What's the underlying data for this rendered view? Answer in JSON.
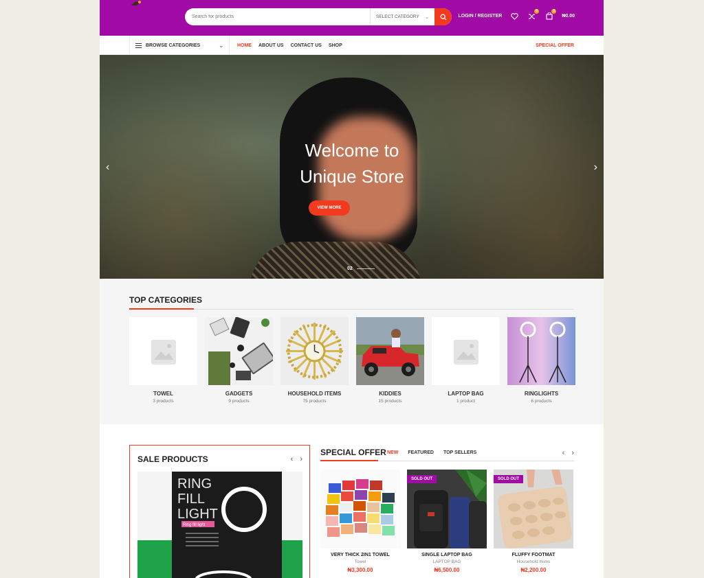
{
  "header": {
    "search_placeholder": "Search for products",
    "select_category": "SELECT CATEGORY",
    "login": "LOGIN / REGISTER",
    "compare_count": "0",
    "cart_count": "0",
    "cart_total": "₦0.00"
  },
  "nav": {
    "browse": "BROWSE CATEGORIES",
    "items": [
      "HOME",
      "ABOUT US",
      "CONTACT US",
      "SHOP"
    ],
    "special": "SPECIAL OFFER"
  },
  "hero": {
    "title_line1": "Welcome to",
    "title_line2": "Unique Store",
    "button": "VIEW MORE",
    "slide_label": "02"
  },
  "top_categories": {
    "title": "TOP CATEGORIES",
    "items": [
      {
        "name": "TOWEL",
        "count": "3 products"
      },
      {
        "name": "GADGETS",
        "count": "9 products"
      },
      {
        "name": "HOUSEHOLD ITEMS",
        "count": "75 products"
      },
      {
        "name": "KIDDIES",
        "count": "15 products"
      },
      {
        "name": "LAPTOP BAG",
        "count": "1 product"
      },
      {
        "name": "RINGLIGHTS",
        "count": "6 products"
      }
    ]
  },
  "sale": {
    "title": "SALE PRODUCTS",
    "image_text": [
      "RING",
      "FILL",
      "LIGHT"
    ],
    "image_tag": "Ring fill light"
  },
  "special_offer": {
    "title": "SPECIAL OFFER",
    "tabs": [
      "NEW",
      "FEATURED",
      "TOP SELLERS"
    ],
    "products": [
      {
        "name": "VERY THICK 2IN1 TOWEL",
        "category": "Towel",
        "price": "₦3,300.00",
        "badge": ""
      },
      {
        "name": "SINGLE LAPTOP BAG",
        "category": "LAPTOP BAG",
        "price": "₦6,500.00",
        "badge": "SOLD OUT"
      },
      {
        "name": "FLUFFY FOOTMAT",
        "category": "Household Items",
        "price": "₦2,200.00",
        "badge": "SOLD OUT"
      }
    ]
  },
  "colors": {
    "brand": "#a20aa6",
    "accent": "#f23a1f"
  }
}
